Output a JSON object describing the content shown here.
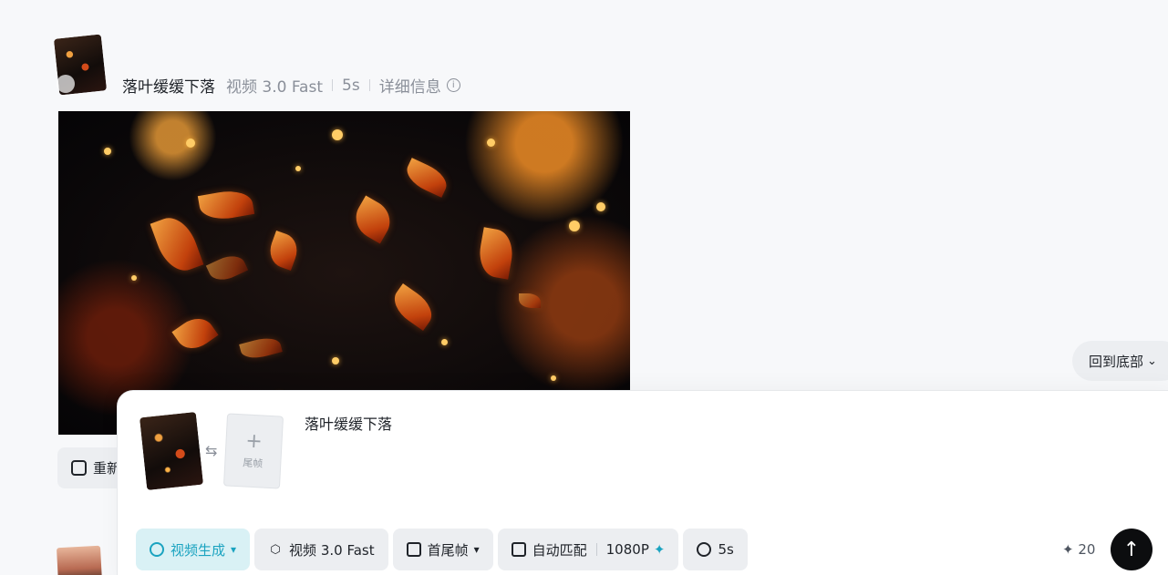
{
  "header": {
    "title": "落叶缓缓下落",
    "model": "视频 3.0 Fast",
    "duration": "5s",
    "details_label": "详细信息"
  },
  "card": {
    "regenerate_label": "重新"
  },
  "scroll_to_bottom": {
    "label": "回到底部"
  },
  "composer": {
    "end_frame_label": "尾帧",
    "prompt_text": "落叶缓缓下落",
    "toolbar": {
      "mode_label": "视频生成",
      "model_label": "视频 3.0 Fast",
      "frames_label": "首尾帧",
      "ratio_label": "自动匹配",
      "resolution_label": "1080P",
      "duration_label": "5s"
    },
    "credits": "20"
  },
  "colors": {
    "accent": "#1aa3c0",
    "active_chip_bg": "#d9f1f5",
    "send_button": "#0c0d0f"
  },
  "icons": [
    "info-icon",
    "edit-icon",
    "swap-icon",
    "plus-icon",
    "video-mode-icon",
    "cube-icon",
    "frames-icon",
    "ratio-icon",
    "sparkle-icon",
    "clock-icon",
    "credit-icon",
    "arrow-up-icon",
    "double-chevron-down-icon"
  ]
}
